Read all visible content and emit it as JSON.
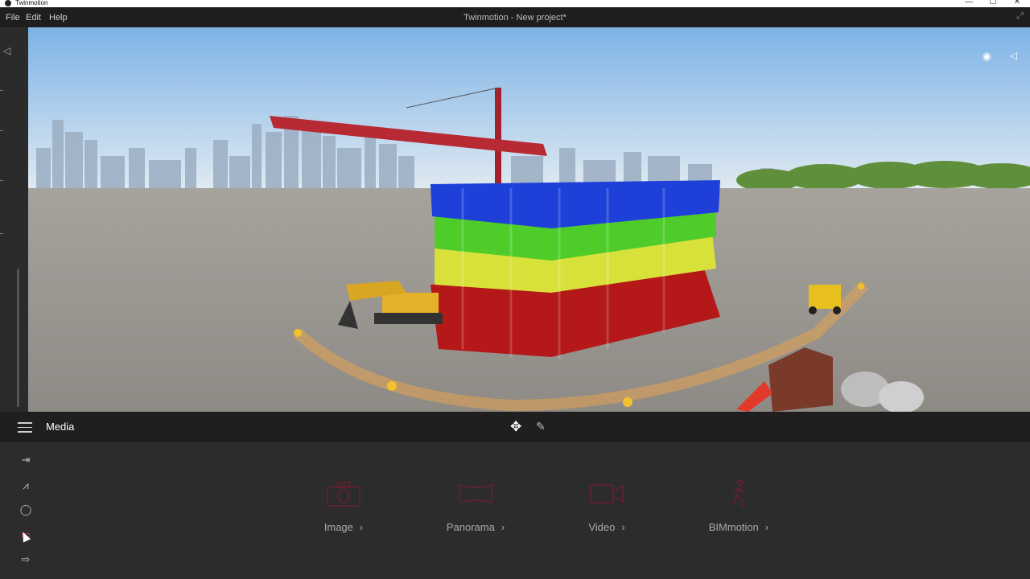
{
  "os": {
    "app_name": "Twinmotion",
    "minimize": "—",
    "maximize": "☐",
    "close": "✕"
  },
  "menubar": {
    "items": [
      "File",
      "Edit",
      "Help"
    ],
    "title": "Twinmotion - New project*",
    "expand": "⤢"
  },
  "viewport": {
    "eye": "◉",
    "collapse": "◁"
  },
  "panel": {
    "section_title": "Media",
    "move_tool": "✥",
    "pen_tool": "✎"
  },
  "side_icons": [
    "import-icon",
    "context-icon",
    "configure-icon",
    "media-icon",
    "export-icon"
  ],
  "media_items": [
    {
      "label": "Image",
      "icon": "camera-icon"
    },
    {
      "label": "Panorama",
      "icon": "panorama-icon"
    },
    {
      "label": "Video",
      "icon": "video-icon"
    },
    {
      "label": "BIMmotion",
      "icon": "walker-icon"
    }
  ],
  "accent": "#e0224e"
}
